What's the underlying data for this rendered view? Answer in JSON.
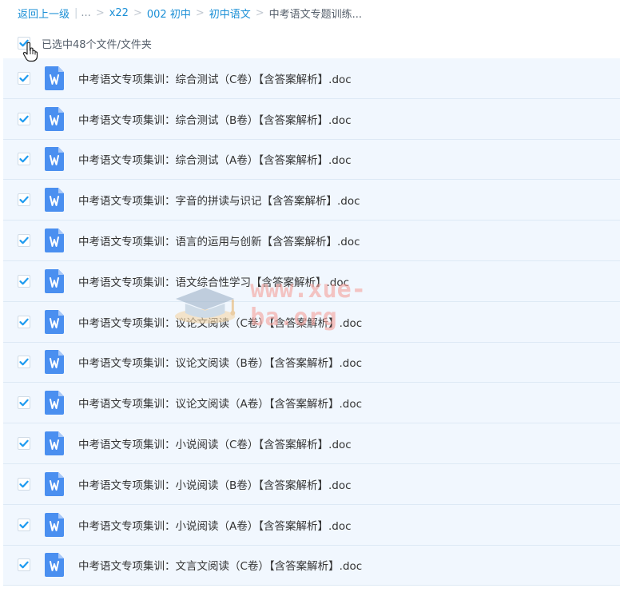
{
  "breadcrumb": {
    "back_label": "返回上一级",
    "ellipsis": "...",
    "items": [
      "x22",
      "002 初中",
      "初中语文"
    ],
    "current": "中考语文专题训练..."
  },
  "selection": {
    "label": "已选中48个文件/文件夹",
    "checked": true
  },
  "files": [
    {
      "name": "中考语文专项集训：综合测试（C卷）【含答案解析】.doc",
      "icon": "word-doc-icon",
      "checked": true
    },
    {
      "name": "中考语文专项集训：综合测试（B卷）【含答案解析】.doc",
      "icon": "word-doc-icon",
      "checked": true
    },
    {
      "name": "中考语文专项集训：综合测试（A卷）【含答案解析】.doc",
      "icon": "word-doc-icon",
      "checked": true
    },
    {
      "name": "中考语文专项集训：字音的拼读与识记【含答案解析】.doc",
      "icon": "word-doc-icon",
      "checked": true
    },
    {
      "name": "中考语文专项集训：语言的运用与创新【含答案解析】.doc",
      "icon": "word-doc-icon",
      "checked": true
    },
    {
      "name": "中考语文专项集训：语文综合性学习【含答案解析】.doc",
      "icon": "word-doc-icon",
      "checked": true
    },
    {
      "name": "中考语文专项集训：议论文阅读（C卷）【含答案解析】.doc",
      "icon": "word-doc-icon",
      "checked": true
    },
    {
      "name": "中考语文专项集训：议论文阅读（B卷）【含答案解析】.doc",
      "icon": "word-doc-icon",
      "checked": true
    },
    {
      "name": "中考语文专项集训：议论文阅读（A卷）【含答案解析】.doc",
      "icon": "word-doc-icon",
      "checked": true
    },
    {
      "name": "中考语文专项集训：小说阅读（C卷）【含答案解析】.doc",
      "icon": "word-doc-icon",
      "checked": true
    },
    {
      "name": "中考语文专项集训：小说阅读（B卷）【含答案解析】.doc",
      "icon": "word-doc-icon",
      "checked": true
    },
    {
      "name": "中考语文专项集训：小说阅读（A卷）【含答案解析】.doc",
      "icon": "word-doc-icon",
      "checked": true
    },
    {
      "name": "中考语文专项集训：文言文阅读（C卷）【含答案解析】.doc",
      "icon": "word-doc-icon",
      "checked": true
    }
  ],
  "watermark": {
    "text": "www.xue-ba.org",
    "icon": "graduation-cap-icon"
  },
  "colors": {
    "accent": "#1a8fd6",
    "checkbox_check": "#1e9bf0",
    "row_background": "#f1f7fe",
    "row_border": "#dde9f5",
    "word_icon": "#4a8ff0",
    "watermark_text": "#f4a6a0"
  },
  "icons": {
    "checkbox_check": "checkmark-icon",
    "cursor": "hand-pointer-icon"
  }
}
